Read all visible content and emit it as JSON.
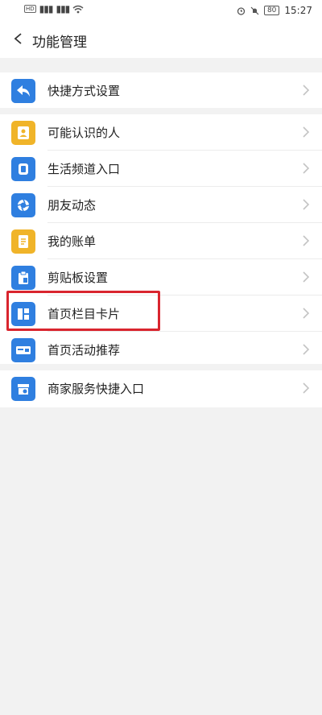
{
  "status": {
    "network1": "HD",
    "network2": "HD",
    "signal": "4G",
    "battery": "80",
    "time": "15:27"
  },
  "header": {
    "title": "功能管理"
  },
  "items": [
    {
      "label": "快捷方式设置",
      "icon": "share-arrow-icon",
      "color": "#2f7fe0"
    },
    {
      "label": "可能认识的人",
      "icon": "contact-card-icon",
      "color": "#f0b429"
    },
    {
      "label": "生活频道入口",
      "icon": "life-channel-icon",
      "color": "#2f7fe0"
    },
    {
      "label": "朋友动态",
      "icon": "friends-feed-icon",
      "color": "#2f7fe0"
    },
    {
      "label": "我的账单",
      "icon": "bill-icon",
      "color": "#f0b429"
    },
    {
      "label": "剪贴板设置",
      "icon": "clipboard-icon",
      "color": "#2f7fe0"
    },
    {
      "label": "首页栏目卡片",
      "icon": "column-cards-icon",
      "color": "#2f7fe0"
    },
    {
      "label": "首页活动推荐",
      "icon": "activity-card-icon",
      "color": "#2f7fe0"
    },
    {
      "label": "商家服务快捷入口",
      "icon": "merchant-store-icon",
      "color": "#2f7fe0"
    }
  ],
  "colors": {
    "highlight": "#d9252e",
    "background": "#f2f2f2"
  }
}
